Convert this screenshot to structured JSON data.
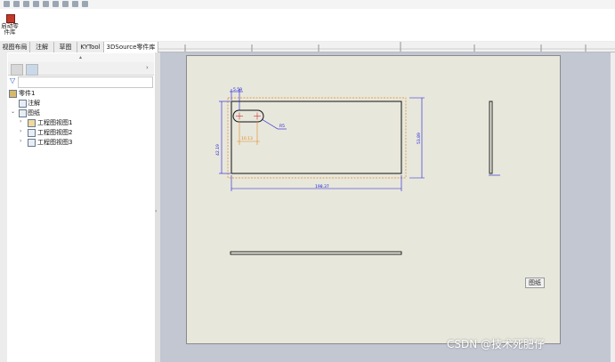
{
  "ribbon": {
    "launch_label_line1": "启动零",
    "launch_label_line2": "件库"
  },
  "tabs": [
    {
      "label": "视图布局"
    },
    {
      "label": "注解"
    },
    {
      "label": "草图"
    },
    {
      "label": "KYTool"
    },
    {
      "label": "3DSource零件库"
    }
  ],
  "tree": {
    "root": "零件1",
    "annotations": "注解",
    "sheet": "图纸",
    "views": [
      "工程图视图1",
      "工程图视图2",
      "工程图视图3"
    ]
  },
  "drawing": {
    "dim_top": "5.59",
    "dim_slot": "10.13",
    "dim_radius": "R5",
    "dim_height_left": "42.19",
    "dim_height_right": "53.89",
    "dim_width": "198.37"
  },
  "sheet_label": "图纸",
  "watermark": "CSDN @技术死肥仔",
  "colors": {
    "dimension": "#1a1ad6",
    "construction": "#e08a1e",
    "sheet": "#e8e7dc",
    "graphics_bg": "#c2c7d2"
  }
}
